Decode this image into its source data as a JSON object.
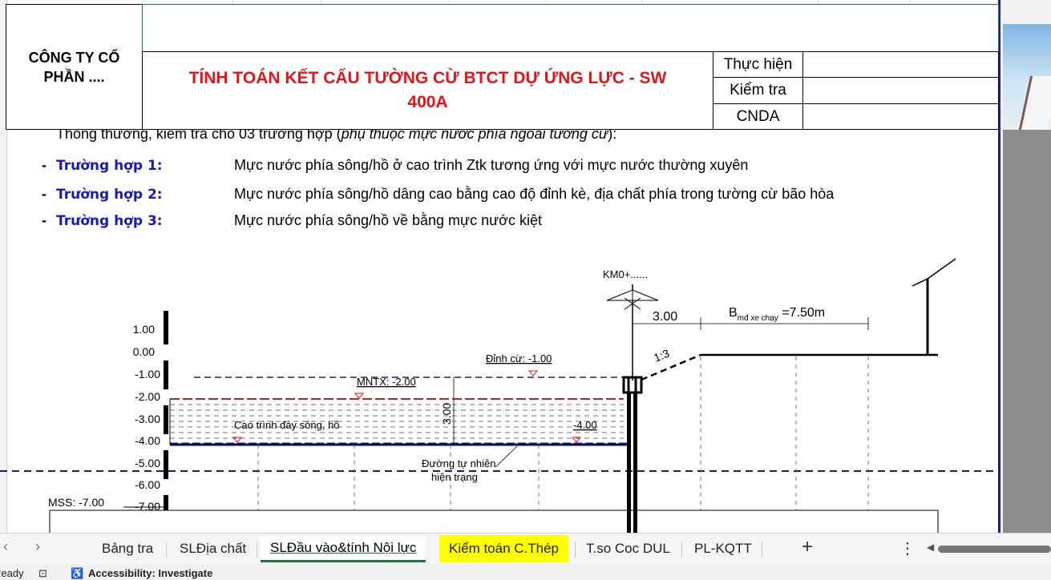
{
  "header": {
    "company": "CÔNG TY CỔ PHẦN ....",
    "title": "TÍNH TOÁN KẾT CẤU TƯỜNG CỪ BTCT DỰ ỨNG LỰC - SW 400A",
    "sign_rows": [
      "Thực hiện",
      "Kiểm tra",
      "CNDA"
    ]
  },
  "intro": {
    "text": "Thông thường, kiểm tra cho 03 trường hợp (",
    "italic": "phụ thuộc mực nước phía ngoài tường cừ",
    "end": "):"
  },
  "cases": [
    {
      "dash": "-",
      "label": "Trường hợp 1:",
      "text": "Mực nước phía sông/hồ ở cao trình Ztk tương ứng với mực nước thường xuyên"
    },
    {
      "dash": "-",
      "label": "Trường hợp 2:",
      "text": "Mực nước phía sông/hồ dâng cao bằng cao độ đỉnh kè, địa chất phía trong tường cừ bão hòa"
    },
    {
      "dash": "-",
      "label": "Trường hợp 3:",
      "text": "Mực nước phía sông/hồ về bằng mực nước kiệt"
    }
  ],
  "diagram": {
    "elevations": [
      "1.00",
      "0.00",
      "-1.00",
      "-2.00",
      "-3.00",
      "-4.00",
      "-5.00",
      "-6.00",
      "-7.00"
    ],
    "mss": "MSS: -7.00",
    "km": "KM0+......",
    "dim_300": "3.00",
    "bmd_prefix": "B",
    "bmd_sub": "mđ xe chạy",
    "bmd_suffix": " =7.50m",
    "slope": "1:3",
    "dinh_cu": "Đỉnh cừ: -1.00",
    "mntx": "MNTX: -2.00",
    "depth": "3.00",
    "cao_trinh": "Cao trình đáy sông, hồ",
    "bottom": "-4.00",
    "duong_tn_1": "Đường tự nhiên",
    "duong_tn_2": "hiện trạng"
  },
  "tabs": [
    "Bảng tra",
    "SLĐịa chất",
    "SLĐầu vào&tính Nội lực",
    "Kiểm toán C.Thép",
    "T.so Coc DUL",
    "PL-KQTT"
  ],
  "status": {
    "ready": "Ready",
    "accessibility": "Accessibility: Investigate"
  },
  "colors": {
    "title_red": "#e4141b",
    "case_blue": "#1a1ab4",
    "active_tab_green": "#217346",
    "highlight_tab": "#ffff00"
  }
}
